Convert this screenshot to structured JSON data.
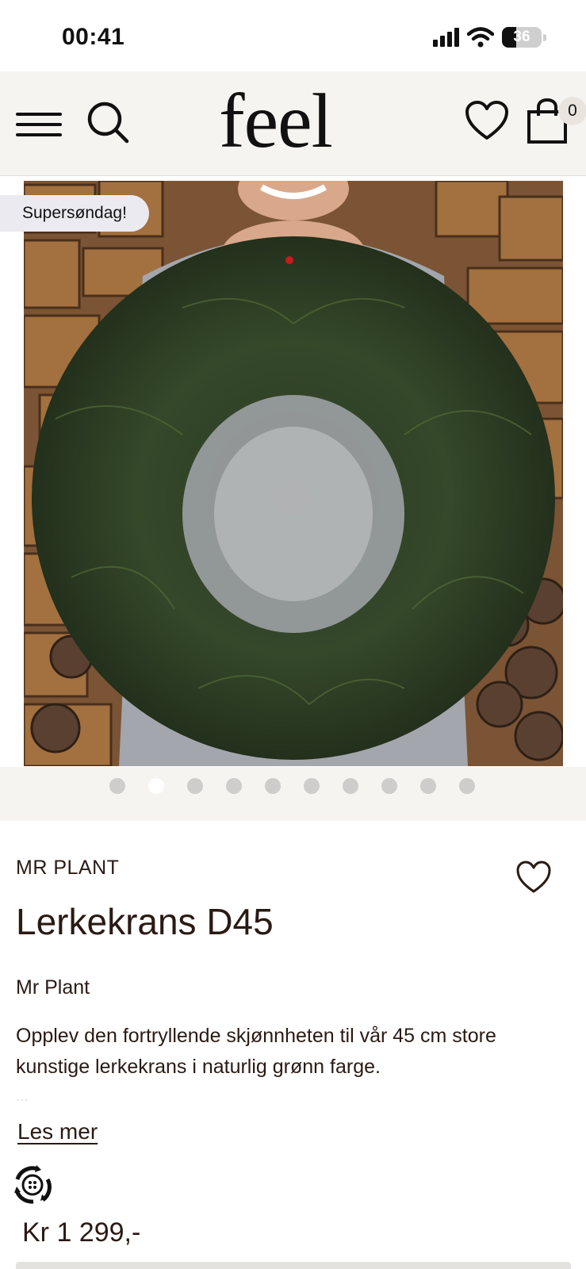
{
  "status_bar": {
    "time": "00:41",
    "battery_level": "36"
  },
  "header": {
    "logo": "feel",
    "cart_count": "0",
    "icons": [
      "menu-icon",
      "search-icon",
      "heart-icon",
      "shopping-bag-icon"
    ]
  },
  "product_image": {
    "badge": "Supersøndag!",
    "carousel_total": 10,
    "carousel_active_index": 1
  },
  "product": {
    "brand_top": "MR PLANT",
    "title": "Lerkekrans D45",
    "brand": "Mr Plant",
    "description": "Opplev den fortryllende skjønnheten til vår 45 cm store kunstige lerkekrans i naturlig grønn farge.",
    "ellipsis": "...",
    "read_more": "Les mer",
    "price": "Kr 1 299,-"
  },
  "colors": {
    "header_bg": "#f6f4f0",
    "text": "#2a1a14",
    "badge_bg": "#ebeaf0",
    "dot_inactive": "#cfcdcb",
    "dot_active": "#ffffff"
  }
}
